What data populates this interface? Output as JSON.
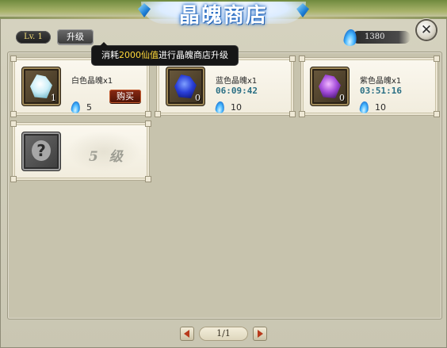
{
  "header": {
    "title": "晶魄商店",
    "level_badge": "Lv. 1",
    "upgrade_label": "升级",
    "currency_value": "1380",
    "currency_icon": "blue-flame-icon"
  },
  "tooltip": {
    "prefix": "消耗",
    "highlight": "2000仙值",
    "suffix": "进行晶魄商店升级"
  },
  "shop_items": [
    {
      "name": "白色晶魄x1",
      "count": "1",
      "price": "5",
      "buy_label": "购买",
      "icon": "white-crystal-icon"
    },
    {
      "name": "蓝色晶魄x1",
      "count": "0",
      "timer": "06:09:42",
      "price": "10",
      "icon": "blue-crystal-icon"
    },
    {
      "name": "紫色晶魄x1",
      "count": "0",
      "timer": "03:51:16",
      "price": "10",
      "icon": "purple-crystal-icon"
    }
  ],
  "locked_slot": {
    "level_text": "5 级",
    "icon": "question-mark-icon"
  },
  "pager": {
    "page": "1/1"
  },
  "colors": {
    "accent_red": "#b83a1c",
    "timer_text": "#2a6f84",
    "tooltip_highlight": "#ffd83a"
  }
}
